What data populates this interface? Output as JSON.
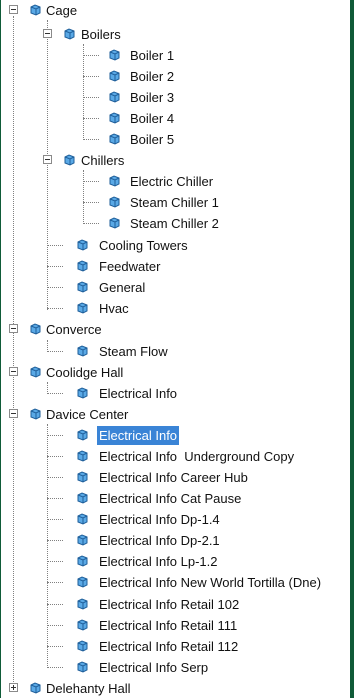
{
  "tree": {
    "cage": "Cage",
    "boilers": "Boilers",
    "boiler1": "Boiler 1",
    "boiler2": "Boiler 2",
    "boiler3": "Boiler 3",
    "boiler4": "Boiler 4",
    "boiler5": "Boiler 5",
    "chillers": "Chillers",
    "electric_chiller": "Electric Chiller",
    "steam_chiller1": "Steam Chiller 1",
    "steam_chiller2": "Steam Chiller 2",
    "cooling_towers": "Cooling Towers",
    "feedwater": "Feedwater",
    "general": "General",
    "hvac": "Hvac",
    "converce": "Converce",
    "steam_flow": "Steam Flow",
    "coolidge_hall": "Coolidge Hall",
    "coolidge_electrical": "Electrical Info",
    "davice_center": "Davice Center",
    "dc_items": [
      "Electrical Info",
      "Electrical Info  Underground Copy",
      "Electrical Info Career Hub",
      "Electrical Info Cat Pause",
      "Electrical Info Dp-1.4",
      "Electrical Info Dp-2.1",
      "Electrical Info Lp-1.2",
      "Electrical Info New World Tortilla (Dne)",
      "Electrical Info Retail 102",
      "Electrical Info Retail 111",
      "Electrical Info Retail 112",
      "Electrical Info Serp"
    ],
    "delehanty_hall": "Delehanty Hall"
  },
  "icon": "cube-icon",
  "colors": {
    "frame": "#0f5b38",
    "selection": "#3a84d6",
    "icon_fill": "#5aa9e6"
  }
}
